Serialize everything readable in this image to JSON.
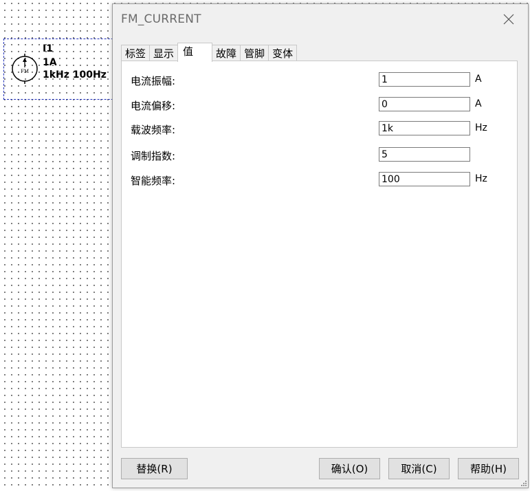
{
  "component": {
    "ref": "I1",
    "amplitude": "1A",
    "freqs": "1kHz 100Hz",
    "symbol_text": "FM"
  },
  "dialog": {
    "title": "FM_CURRENT",
    "tabs": [
      {
        "label": "标签"
      },
      {
        "label": "显示"
      },
      {
        "label": "值",
        "active": true
      },
      {
        "label": "故障"
      },
      {
        "label": "管脚"
      },
      {
        "label": "变体"
      }
    ],
    "fields": [
      {
        "label": "电流振幅:",
        "value": "1",
        "unit": "A"
      },
      {
        "label": "电流偏移:",
        "value": "0",
        "unit": "A"
      },
      {
        "label": "载波频率:",
        "value": "1k",
        "unit": "Hz"
      },
      {
        "label": "调制指数:",
        "value": "5",
        "unit": ""
      },
      {
        "label": "智能频率:",
        "value": "100",
        "unit": "Hz"
      }
    ],
    "buttons": {
      "replace": "替换(R)",
      "ok": "确认(O)",
      "cancel": "取消(C)",
      "help": "帮助(H)"
    }
  }
}
